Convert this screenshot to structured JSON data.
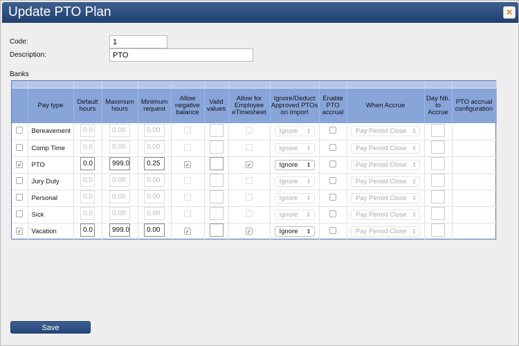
{
  "title": "Update PTO Plan",
  "close_icon": "close-x-icon",
  "form": {
    "code_label": "Code:",
    "code_value": "1",
    "description_label": "Description:",
    "description_value": "PTO"
  },
  "banks_label": "Banks",
  "columns": [
    "",
    "Pay type",
    "Default hours",
    "Maximum hours",
    "Minimum request",
    "Allow negative balance",
    "Valid values",
    "Allow for Employee eTimesheet",
    "Ignore/Deduct Approved PTOs on Import",
    "Enable PTO accrual",
    "When Accrue",
    "Day Nb. to Accrue",
    "PTO accrual configuration"
  ],
  "rows": [
    {
      "selected": false,
      "pay_type": "Bereavement",
      "default_hours": "0.0",
      "maximum_hours": "0.00",
      "minimum_request": "0.00",
      "allow_negative": false,
      "allow_etimesheet": false,
      "ignore_deduct": "Ignore",
      "enable_accrual": false,
      "when_accrue": "Pay Period Close"
    },
    {
      "selected": false,
      "pay_type": "Comp Time",
      "default_hours": "0.0",
      "maximum_hours": "0.00",
      "minimum_request": "0.00",
      "allow_negative": false,
      "allow_etimesheet": false,
      "ignore_deduct": "Ignore",
      "enable_accrual": false,
      "when_accrue": "Pay Period Close"
    },
    {
      "selected": true,
      "pay_type": "PTO",
      "default_hours": "0.0",
      "maximum_hours": "999.0",
      "minimum_request": "0.25",
      "allow_negative": true,
      "allow_etimesheet": true,
      "ignore_deduct": "Ignore",
      "enable_accrual": false,
      "when_accrue": "Pay Period Close"
    },
    {
      "selected": false,
      "pay_type": "Jury Duty",
      "default_hours": "0.0",
      "maximum_hours": "0.00",
      "minimum_request": "0.00",
      "allow_negative": false,
      "allow_etimesheet": false,
      "ignore_deduct": "Ignore",
      "enable_accrual": false,
      "when_accrue": "Pay Period Close"
    },
    {
      "selected": false,
      "pay_type": "Personal",
      "default_hours": "0.0",
      "maximum_hours": "0.00",
      "minimum_request": "0.00",
      "allow_negative": false,
      "allow_etimesheet": false,
      "ignore_deduct": "Ignore",
      "enable_accrual": false,
      "when_accrue": "Pay Period Close"
    },
    {
      "selected": false,
      "pay_type": "Sick",
      "default_hours": "0.0",
      "maximum_hours": "0.00",
      "minimum_request": "0.00",
      "allow_negative": false,
      "allow_etimesheet": false,
      "ignore_deduct": "Ignore",
      "enable_accrual": false,
      "when_accrue": "Pay Period Close"
    },
    {
      "selected": true,
      "pay_type": "Vacation",
      "default_hours": "0.0",
      "maximum_hours": "999.0",
      "minimum_request": "0.00",
      "allow_negative": true,
      "allow_etimesheet": true,
      "ignore_deduct": "Ignore",
      "enable_accrual": false,
      "when_accrue": "Pay Period Close"
    }
  ],
  "save_label": "Save",
  "colors": {
    "titlebar": "#2f507f",
    "header": "#88a5da",
    "close_x": "#e08a1a"
  }
}
